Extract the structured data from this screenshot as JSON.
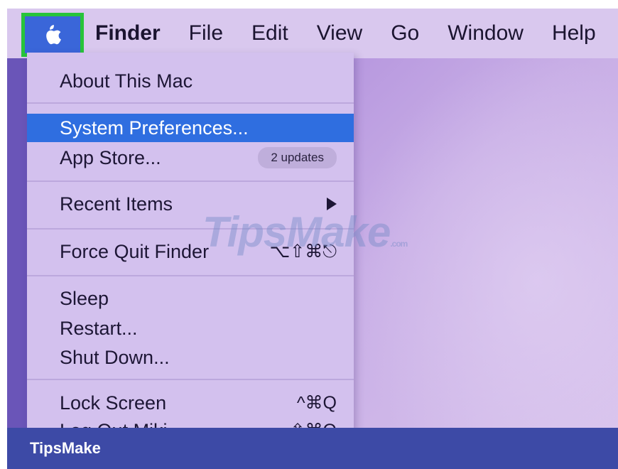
{
  "menubar": {
    "apple_icon": "apple-logo-icon",
    "items": [
      {
        "label": "Finder",
        "bold": true
      },
      {
        "label": "File"
      },
      {
        "label": "Edit"
      },
      {
        "label": "View"
      },
      {
        "label": "Go"
      },
      {
        "label": "Window"
      },
      {
        "label": "Help"
      }
    ]
  },
  "apple_menu": {
    "about": "About This Mac",
    "system_preferences": "System Preferences...",
    "app_store": "App Store...",
    "app_store_badge": "2 updates",
    "recent_items": "Recent Items",
    "force_quit": "Force Quit Finder",
    "force_quit_shortcut": "⌥⇧⌘⎋",
    "sleep": "Sleep",
    "restart": "Restart...",
    "shut_down": "Shut Down...",
    "lock_screen": "Lock Screen",
    "lock_screen_shortcut": "^⌘Q",
    "log_out": "Log Out Miki",
    "log_out_shortcut": "⇧⌘Q"
  },
  "watermark": {
    "text": "TipsMake",
    "suffix": ".com"
  },
  "footer": {
    "brand": "TipsMake"
  },
  "colors": {
    "highlight": "#2f6ee0",
    "apple_button_border": "#27c43a",
    "footer_bar": "#3d4aa6"
  }
}
